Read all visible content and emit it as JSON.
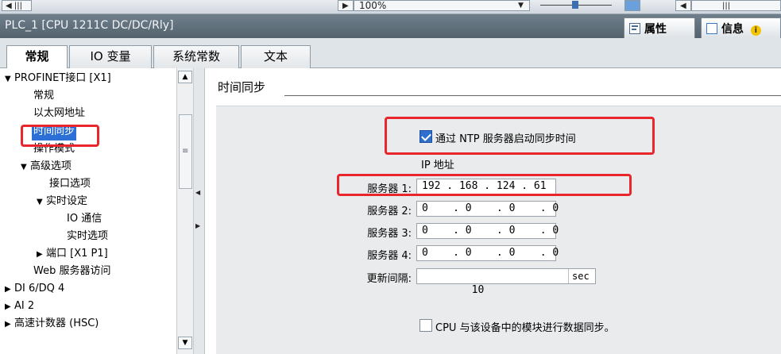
{
  "toolbar": {
    "zoom": "100%"
  },
  "window": {
    "title": "PLC_1 [CPU 1211C DC/DC/Rly]"
  },
  "panel_tabs": [
    {
      "label": "属性",
      "icon": "properties-icon"
    },
    {
      "label": "信息",
      "icon": "info-icon"
    }
  ],
  "tabs": [
    "常规",
    "IO 变量",
    "系统常数",
    "文本"
  ],
  "nav": {
    "items": [
      {
        "label": "PROFINET接口 [X1]",
        "arrow": "▼"
      },
      {
        "label": "常规",
        "arrow": ""
      },
      {
        "label": "以太网地址",
        "arrow": ""
      },
      {
        "label": "时间同步",
        "arrow": ""
      },
      {
        "label": "操作模式",
        "arrow": ""
      },
      {
        "label": "高级选项",
        "arrow": "▼"
      },
      {
        "label": "接口选项",
        "arrow": ""
      },
      {
        "label": "实时设定",
        "arrow": "▼"
      },
      {
        "label": "IO 通信",
        "arrow": ""
      },
      {
        "label": "实时选项",
        "arrow": ""
      },
      {
        "label": "端口 [X1 P1]",
        "arrow": "▶"
      },
      {
        "label": "Web 服务器访问",
        "arrow": ""
      },
      {
        "label": "DI 6/DQ 4",
        "arrow": "▶"
      },
      {
        "label": "AI 2",
        "arrow": "▶"
      },
      {
        "label": "高速计数器 (HSC)",
        "arrow": "▶"
      }
    ]
  },
  "section": {
    "title": "时间同步",
    "ntp_checkbox_label": "通过 NTP 服务器启动同步时间",
    "ntp_checked": true,
    "ip_header": "IP 地址",
    "servers": [
      {
        "label": "服务器 1:",
        "value": "192 . 168 . 124 . 61"
      },
      {
        "label": "服务器 2:",
        "value": "0    . 0    . 0    . 0"
      },
      {
        "label": "服务器 3:",
        "value": "0    . 0    . 0    . 0"
      },
      {
        "label": "服务器 4:",
        "value": "0    . 0    . 0    . 0"
      }
    ],
    "interval_label": "更新间隔:",
    "interval_value": "10",
    "interval_unit": "sec",
    "sync_checkbox_label": "CPU 与该设备中的模块进行数据同步。",
    "sync_checked": false
  },
  "colors": {
    "highlight": "#e8262c",
    "selection": "#2c6fd6",
    "titlebar": "#5f6e79"
  }
}
